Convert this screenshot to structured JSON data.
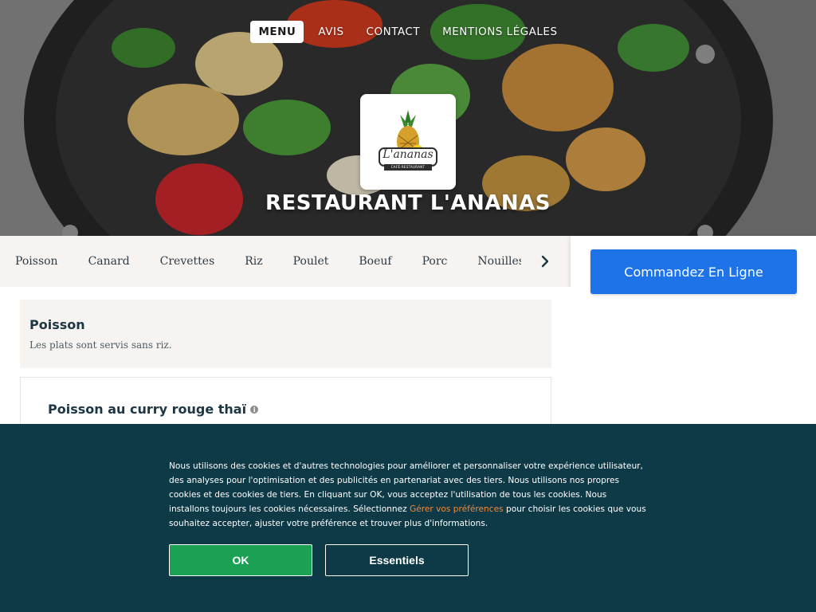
{
  "nav": {
    "items": [
      {
        "label": "MENU",
        "active": true
      },
      {
        "label": "AVIS"
      },
      {
        "label": "CONTACT"
      },
      {
        "label": "MENTIONS LÉGALES"
      }
    ]
  },
  "logo": {
    "wordmark": "L'ananas",
    "subtitle": "CAFÉ·RESTAURANT"
  },
  "hero": {
    "title": "RESTAURANT L'ANANAS"
  },
  "categories": {
    "items": [
      "Poisson",
      "Canard",
      "Crevettes",
      "Riz",
      "Poulet",
      "Boeuf",
      "Porc",
      "Nouilles et p"
    ],
    "next_icon": "chevron-right-icon"
  },
  "order": {
    "label": "Commandez En Ligne"
  },
  "section": {
    "title": "Poisson",
    "description": "Les plats sont servis sans riz."
  },
  "dish": {
    "name": "Poisson au curry rouge thaï",
    "info_icon": "info-icon"
  },
  "cookie": {
    "text_before": "Nous utilisons des cookies et d'autres technologies pour améliorer et personnaliser votre expérience utilisateur, des analyses pour l'optimisation et des publicités en partenariat avec des tiers. Nous utilisons nos propres cookies et des cookies de tiers. En cliquant sur OK, vous acceptez l'utilisation de tous les cookies. Nous installons toujours les cookies nécessaires. Sélectionnez ",
    "link": "Gérer vos préférences",
    "text_after": " pour choisir les cookies que vous souhaitez accepter, ajuster votre préférence et trouver plus d'informations.",
    "ok_label": "OK",
    "essentials_label": "Essentiels"
  },
  "colors": {
    "order_button": "#1e73e8",
    "cookie_banner": "#0e3a47",
    "ok_button": "#1aa154",
    "cookie_link": "#f08a3c",
    "category_bar": "#f6f3f0"
  }
}
